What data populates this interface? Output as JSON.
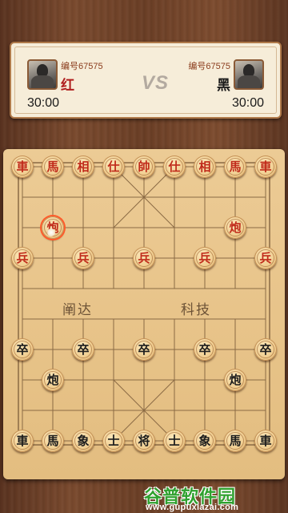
{
  "player_red": {
    "id_label": "编号67575",
    "name": "红",
    "timer": "30:00"
  },
  "player_black": {
    "id_label": "编号67575",
    "name": "黑",
    "timer": "30:00"
  },
  "vs_label": "VS",
  "river": {
    "left": "阐达",
    "right": "科技"
  },
  "watermark": {
    "title": "谷普软件园",
    "url": "www.gupuxiazai.com"
  },
  "colors": {
    "red_piece": "#c02a1a",
    "black_piece": "#1c1c1c",
    "board": "#e8c48a"
  },
  "board_grid": {
    "files": 9,
    "ranks": 10
  },
  "selected_position": {
    "file": 1,
    "rank": 2
  },
  "pieces": [
    {
      "char": "車",
      "side": "red",
      "file": 0,
      "rank": 0
    },
    {
      "char": "馬",
      "side": "red",
      "file": 1,
      "rank": 0
    },
    {
      "char": "相",
      "side": "red",
      "file": 2,
      "rank": 0
    },
    {
      "char": "仕",
      "side": "red",
      "file": 3,
      "rank": 0
    },
    {
      "char": "帥",
      "side": "red",
      "file": 4,
      "rank": 0
    },
    {
      "char": "仕",
      "side": "red",
      "file": 5,
      "rank": 0
    },
    {
      "char": "相",
      "side": "red",
      "file": 6,
      "rank": 0
    },
    {
      "char": "馬",
      "side": "red",
      "file": 7,
      "rank": 0
    },
    {
      "char": "車",
      "side": "red",
      "file": 8,
      "rank": 0
    },
    {
      "char": "炮",
      "side": "red",
      "file": 1,
      "rank": 2
    },
    {
      "char": "炮",
      "side": "red",
      "file": 7,
      "rank": 2
    },
    {
      "char": "兵",
      "side": "red",
      "file": 0,
      "rank": 3
    },
    {
      "char": "兵",
      "side": "red",
      "file": 2,
      "rank": 3
    },
    {
      "char": "兵",
      "side": "red",
      "file": 4,
      "rank": 3
    },
    {
      "char": "兵",
      "side": "red",
      "file": 6,
      "rank": 3
    },
    {
      "char": "兵",
      "side": "red",
      "file": 8,
      "rank": 3
    },
    {
      "char": "卒",
      "side": "black",
      "file": 0,
      "rank": 6
    },
    {
      "char": "卒",
      "side": "black",
      "file": 2,
      "rank": 6
    },
    {
      "char": "卒",
      "side": "black",
      "file": 4,
      "rank": 6
    },
    {
      "char": "卒",
      "side": "black",
      "file": 6,
      "rank": 6
    },
    {
      "char": "卒",
      "side": "black",
      "file": 8,
      "rank": 6
    },
    {
      "char": "炮",
      "side": "black",
      "file": 1,
      "rank": 7
    },
    {
      "char": "炮",
      "side": "black",
      "file": 7,
      "rank": 7
    },
    {
      "char": "車",
      "side": "black",
      "file": 0,
      "rank": 9
    },
    {
      "char": "馬",
      "side": "black",
      "file": 1,
      "rank": 9
    },
    {
      "char": "象",
      "side": "black",
      "file": 2,
      "rank": 9
    },
    {
      "char": "士",
      "side": "black",
      "file": 3,
      "rank": 9
    },
    {
      "char": "将",
      "side": "black",
      "file": 4,
      "rank": 9
    },
    {
      "char": "士",
      "side": "black",
      "file": 5,
      "rank": 9
    },
    {
      "char": "象",
      "side": "black",
      "file": 6,
      "rank": 9
    },
    {
      "char": "馬",
      "side": "black",
      "file": 7,
      "rank": 9
    },
    {
      "char": "車",
      "side": "black",
      "file": 8,
      "rank": 9
    }
  ],
  "move_marker": {
    "file": 0,
    "rank": 2
  }
}
